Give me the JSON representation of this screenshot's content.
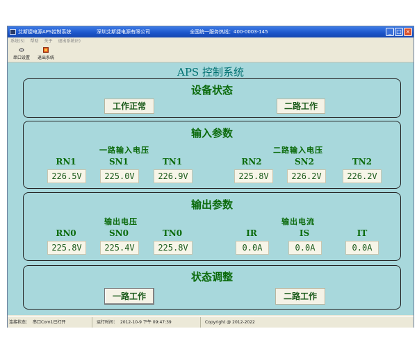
{
  "window": {
    "title": "艾斯捷电源APS控制系统",
    "company": "深圳艾斯捷电源有限公司",
    "hotline": "全国统一服务热线：400-0003-145"
  },
  "menu": [
    "系统(S)",
    "帮助",
    "关于",
    "退出系统(E)"
  ],
  "toolbar": {
    "port_settings": "串口设置",
    "exit_system": "退出系统"
  },
  "app_title": "APS 控制系统",
  "device_status": {
    "title": "设备状态",
    "work_status": "工作正常",
    "mode": "二路工作"
  },
  "input": {
    "title": "输入参数",
    "group1": {
      "label": "一路输入电压",
      "channels": [
        {
          "name": "RN1",
          "value": "226.5V"
        },
        {
          "name": "SN1",
          "value": "225.0V"
        },
        {
          "name": "TN1",
          "value": "226.9V"
        }
      ]
    },
    "group2": {
      "label": "二路输入电压",
      "channels": [
        {
          "name": "RN2",
          "value": "225.8V"
        },
        {
          "name": "SN2",
          "value": "226.2V"
        },
        {
          "name": "TN2",
          "value": "226.2V"
        }
      ]
    }
  },
  "output": {
    "title": "输出参数",
    "voltage": {
      "label": "输出电压",
      "channels": [
        {
          "name": "RN0",
          "value": "225.8V"
        },
        {
          "name": "SN0",
          "value": "225.4V"
        },
        {
          "name": "TN0",
          "value": "225.8V"
        }
      ]
    },
    "current": {
      "label": "输出电流",
      "channels": [
        {
          "name": "IR",
          "value": "0.0A"
        },
        {
          "name": "IS",
          "value": "0.0A"
        },
        {
          "name": "IT",
          "value": "0.0A"
        }
      ]
    }
  },
  "adjust": {
    "title": "状态调整",
    "btn1": "一路工作",
    "btn2": "二路工作"
  },
  "status": {
    "conn_label": "连接状态：",
    "conn_value": "串口Com1已打开",
    "time_label": "运行时间：",
    "time_value": "2012-10-9 下午 09:47:39",
    "copyright": "Copyright @ 2012-2022"
  }
}
